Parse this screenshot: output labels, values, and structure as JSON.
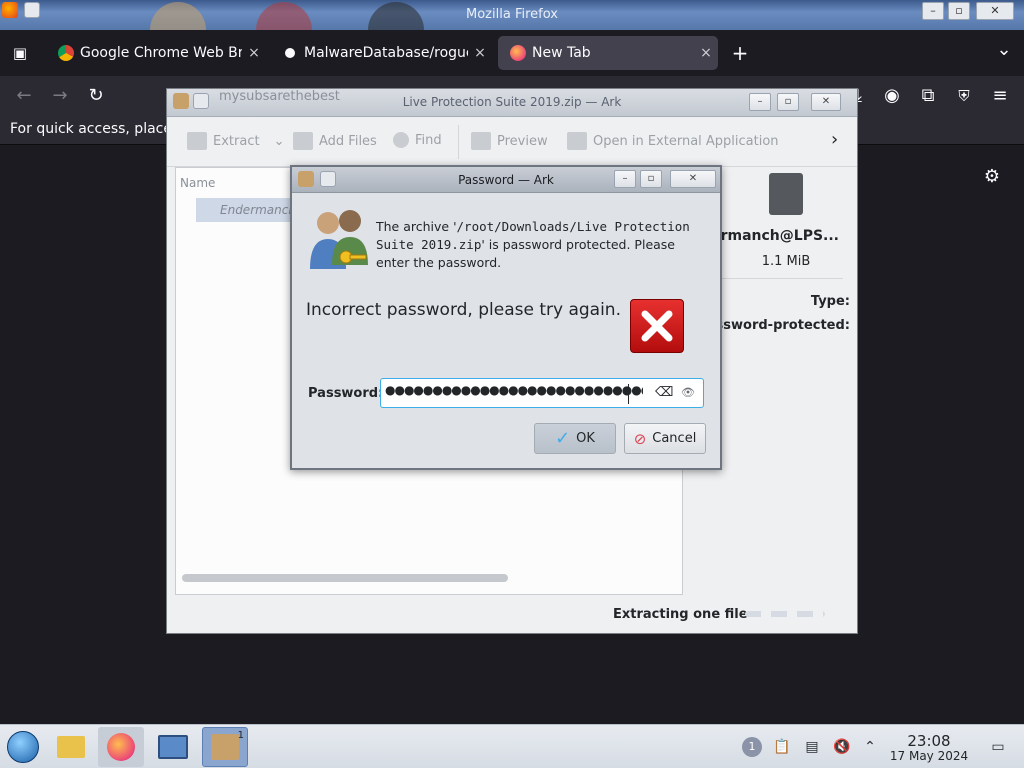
{
  "firefox": {
    "window_title": "Mozilla Firefox",
    "tabs": [
      {
        "label": "Google Chrome Web Bro",
        "close": "×"
      },
      {
        "label": "MalwareDatabase/rogue",
        "close": "×"
      },
      {
        "label": "New Tab",
        "close": "×"
      }
    ],
    "new_tab": "+",
    "tab_list": "⌄",
    "bookmarks_hint": "For quick access, place"
  },
  "ark": {
    "user_label": "mysubsarethebest",
    "window_title": "Live Protection Suite 2019.zip — Ark",
    "toolbar": {
      "extract": "Extract",
      "add_files": "Add Files",
      "find": "Find",
      "preview": "Preview",
      "open_external": "Open in External Application"
    },
    "list": {
      "column_name": "Name",
      "row": "Endermanch"
    },
    "side": {
      "name": "ermanch@LPS...",
      "size": "1.1 MiB",
      "type_label": "Type:",
      "pw_label": "ssword-protected:"
    },
    "status": "Extracting one file"
  },
  "dialog": {
    "title": "Password — Ark",
    "message_pre": "The archive '",
    "message_path": "/root/Downloads/Live Protection Suite 2019.zip",
    "message_post": "' is password protected. Please enter the password.",
    "error": "Incorrect password, please try again.",
    "password_label": "Password:",
    "password_dots": "●●●●●●●●●●●●●●●●●●●●●●●●●●●●●●●●●●●",
    "ok": "OK",
    "cancel": "Cancel"
  },
  "taskbar": {
    "clock_time": "23:08",
    "clock_date": "17 May 2024",
    "badge": "1"
  }
}
